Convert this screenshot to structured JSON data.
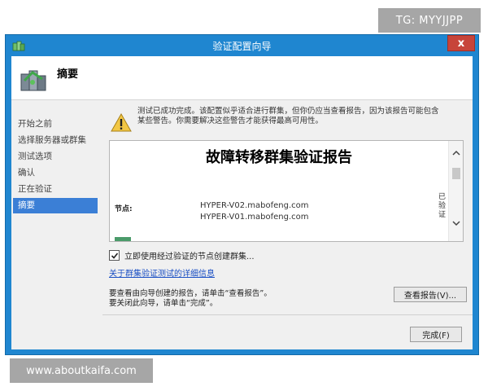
{
  "watermarks": {
    "top": "TG: MYYJJPP",
    "bottom": "www.aboutkaifa.com"
  },
  "window": {
    "title": "验证配置向导",
    "close_symbol": "x"
  },
  "header": {
    "title": "摘要"
  },
  "nav": {
    "items": [
      {
        "label": "开始之前"
      },
      {
        "label": "选择服务器或群集"
      },
      {
        "label": "测试选项"
      },
      {
        "label": "确认"
      },
      {
        "label": "正在验证"
      },
      {
        "label": "摘要"
      }
    ],
    "active_index": 5
  },
  "warning": {
    "line1": "测试已成功完成。该配置似乎适合进行群集，但你仍应当查看报告，因为该报告可能包含",
    "line2": "某些警告。你需要解决这些警告才能获得最高可用性。"
  },
  "report": {
    "title": "故障转移群集验证报告",
    "node_label": "节点:",
    "nodes": [
      "HYPER-V02.mabofeng.com",
      "HYPER-V01.mabofeng.com"
    ],
    "verified_text": "已验证"
  },
  "create_cluster": {
    "checked": true,
    "label": "立即使用经过验证的节点创建群集..."
  },
  "details_link": "关于群集验证测试的详细信息",
  "info": {
    "line1": "要查看由向导创建的报告，请单击“查看报告”。",
    "line2": "要关闭此向导，请单击“完成”。"
  },
  "buttons": {
    "view_report": "查看报告(V)...",
    "finish": "完成(F)"
  },
  "colors": {
    "titlebar": "#1f86d0",
    "close": "#c7443a",
    "nav_active": "#3b7fd6",
    "link": "#1a4fc4",
    "warning": "#f2c744"
  }
}
